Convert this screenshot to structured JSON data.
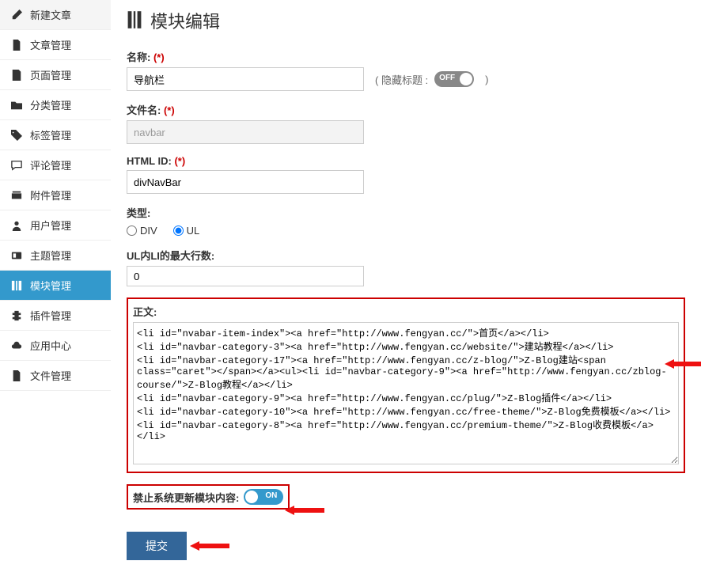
{
  "sidebar": {
    "items": [
      {
        "label": "新建文章"
      },
      {
        "label": "文章管理"
      },
      {
        "label": "页面管理"
      },
      {
        "label": "分类管理"
      },
      {
        "label": "标签管理"
      },
      {
        "label": "评论管理"
      },
      {
        "label": "附件管理"
      },
      {
        "label": "用户管理"
      },
      {
        "label": "主题管理"
      },
      {
        "label": "模块管理"
      },
      {
        "label": "插件管理"
      },
      {
        "label": "应用中心"
      },
      {
        "label": "文件管理"
      }
    ]
  },
  "page": {
    "title": "模块编辑"
  },
  "form": {
    "name_label": "名称:",
    "name_value": "导航栏",
    "hide_title_label": "( 隐藏标题 :",
    "hide_title_state": "OFF",
    "close_paren": ")",
    "filename_label": "文件名:",
    "filename_value": "navbar",
    "htmlid_label": "HTML ID:",
    "htmlid_value": "divNavBar",
    "type_label": "类型:",
    "type_options": {
      "div": "DIV",
      "ul": "UL"
    },
    "maxrows_label": "UL内LI的最大行数:",
    "maxrows_value": "0",
    "content_label": "正文:",
    "content_value": "<li id=\"nvabar-item-index\"><a href=\"http://www.fengyan.cc/\">首页</a></li>\n<li id=\"navbar-category-3\"><a href=\"http://www.fengyan.cc/website/\">建站教程</a></li>\n<li id=\"navbar-category-17\"><a href=\"http://www.fengyan.cc/z-blog/\">Z-Blog建站<span class=\"caret\"></span></a><ul><li id=\"navbar-category-9\"><a href=\"http://www.fengyan.cc/zblog-course/\">Z-Blog教程</a></li>\n<li id=\"navbar-category-9\"><a href=\"http://www.fengyan.cc/plug/\">Z-Blog插件</a></li>\n<li id=\"navbar-category-10\"><a href=\"http://www.fengyan.cc/free-theme/\">Z-Blog免费模板</a></li>\n<li id=\"navbar-category-8\"><a href=\"http://www.fengyan.cc/premium-theme/\">Z-Blog收费模板</a></li>",
    "lock_label": "禁止系统更新模块内容:",
    "lock_state": "ON",
    "submit_label": "提交",
    "required_mark": "(*)"
  }
}
